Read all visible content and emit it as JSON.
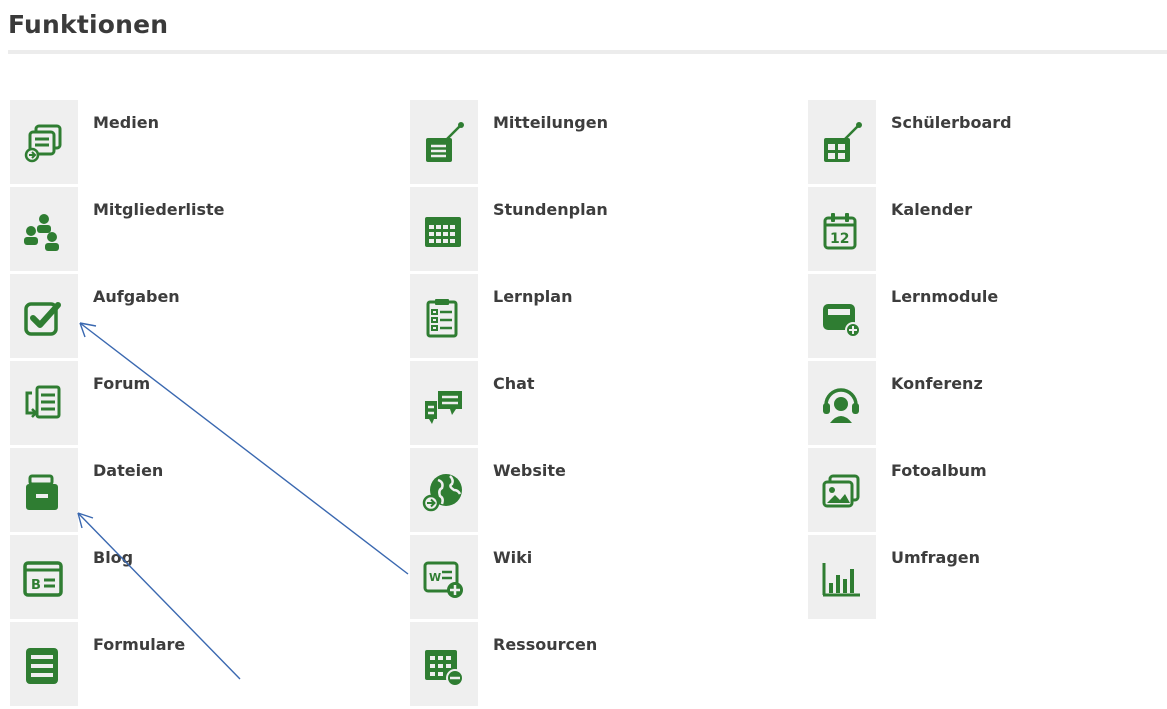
{
  "page": {
    "title": "Funktionen"
  },
  "colors": {
    "accent": "#2f7d32",
    "tile": "#efefef",
    "arrow": "#3a68b0"
  },
  "columns": [
    {
      "items": [
        {
          "label": "Medien",
          "icon": "media-icon"
        },
        {
          "label": "Mitgliederliste",
          "icon": "members-icon"
        },
        {
          "label": "Aufgaben",
          "icon": "tasks-checkbox-icon"
        },
        {
          "label": "Forum",
          "icon": "forum-icon"
        },
        {
          "label": "Dateien",
          "icon": "files-briefcase-icon"
        },
        {
          "label": "Blog",
          "icon": "blog-icon"
        },
        {
          "label": "Formulare",
          "icon": "forms-icon"
        }
      ]
    },
    {
      "items": [
        {
          "label": "Mitteilungen",
          "icon": "announcements-icon"
        },
        {
          "label": "Stundenplan",
          "icon": "timetable-icon"
        },
        {
          "label": "Lernplan",
          "icon": "learning-plan-icon"
        },
        {
          "label": "Chat",
          "icon": "chat-icon"
        },
        {
          "label": "Website",
          "icon": "website-globe-icon"
        },
        {
          "label": "Wiki",
          "icon": "wiki-icon"
        },
        {
          "label": "Ressourcen",
          "icon": "resources-icon"
        }
      ]
    },
    {
      "items": [
        {
          "label": "Schülerboard",
          "icon": "student-board-icon"
        },
        {
          "label": "Kalender",
          "icon": "calendar-icon"
        },
        {
          "label": "Lernmodule",
          "icon": "learning-modules-icon"
        },
        {
          "label": "Konferenz",
          "icon": "conference-headset-icon"
        },
        {
          "label": "Fotoalbum",
          "icon": "photo-album-icon"
        },
        {
          "label": "Umfragen",
          "icon": "survey-chart-icon"
        }
      ]
    }
  ],
  "calendar_icon_day": "12"
}
